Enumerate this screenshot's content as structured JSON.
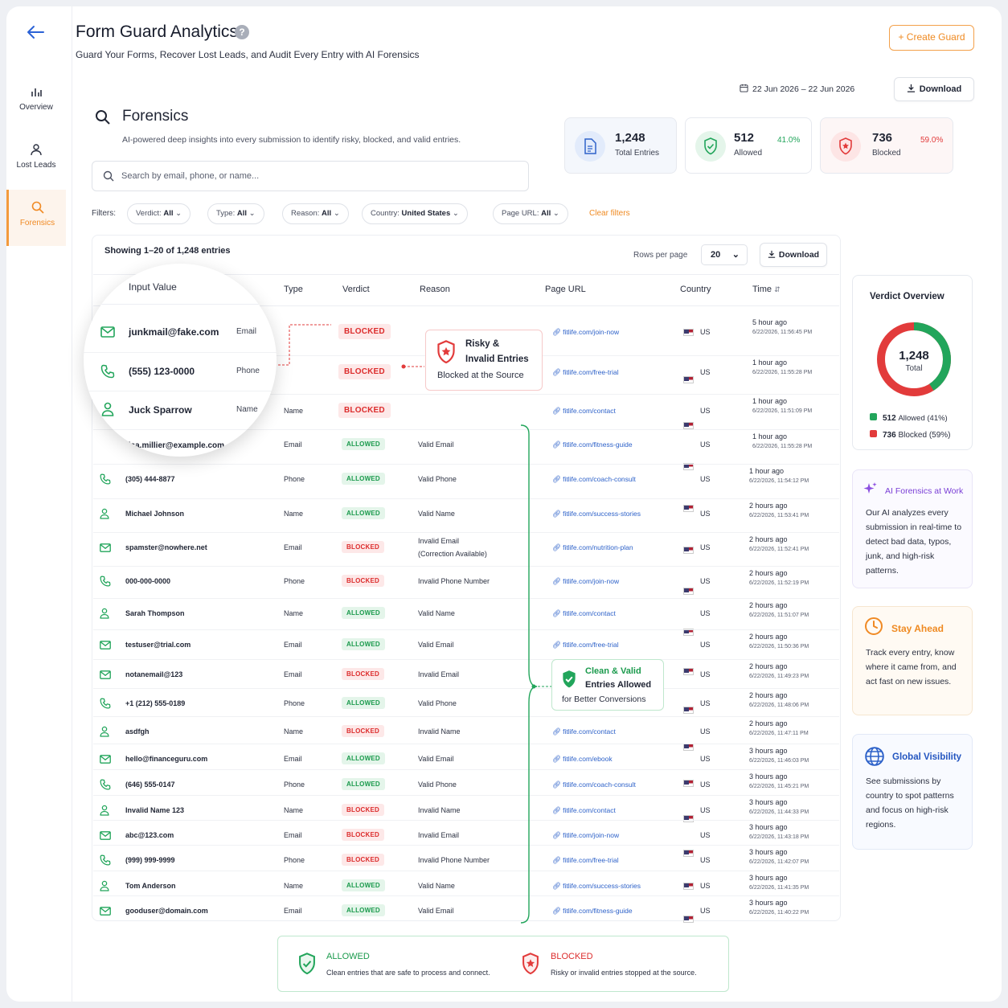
{
  "header": {
    "title": "Form Guard Analytics",
    "help": "?",
    "subtitle": "Guard Your Forms, Recover Lost Leads, and Audit Every Entry with AI Forensics",
    "create_button": "+ Create Guard",
    "date_range": "22 Jun 2026 – 22 Jun 2026",
    "download_button": "Download"
  },
  "sidebar": {
    "items": [
      {
        "label": "Overview",
        "icon": "bar-chart-icon"
      },
      {
        "label": "Lost Leads",
        "icon": "user-icon"
      },
      {
        "label": "Forensics",
        "icon": "search-icon",
        "active": true
      }
    ]
  },
  "forensics": {
    "title": "Forensics",
    "subtitle": "AI-powered deep insights into every submission to identify risky, blocked, and valid entries.",
    "search_placeholder": "Search by email, phone, or name..."
  },
  "stats": {
    "total": {
      "value": "1,248",
      "label": "Total Entries"
    },
    "allowed": {
      "value": "512",
      "label": "Allowed",
      "pct": "41.0%"
    },
    "blocked": {
      "value": "736",
      "label": "Blocked",
      "pct": "59.0%"
    }
  },
  "filters": {
    "label": "Filters:",
    "chips": [
      {
        "name": "Verdict:",
        "value": "All"
      },
      {
        "name": "Type:",
        "value": "All"
      },
      {
        "name": "Reason:",
        "value": "All"
      },
      {
        "name": "Country:",
        "value": "United States"
      },
      {
        "name": "Page URL:",
        "value": "All"
      }
    ],
    "clear": "Clear filters"
  },
  "table": {
    "showing": "Showing 1–20 of 1,248 entries",
    "rows_per_page_label": "Rows per page",
    "rows_per_page": "20",
    "download": "Download",
    "headers": {
      "input": "Input Value",
      "type": "Type",
      "verdict": "Verdict",
      "reason": "Reason",
      "url": "Page URL",
      "country": "Country",
      "time": "Time"
    },
    "rows": [
      {
        "value": "junkmail@fake.com",
        "type": "Email",
        "verdict": "BLOCKED",
        "reason": "",
        "url": "fitlife.com/join-now",
        "country": "US",
        "ago": "5 hour ago",
        "ts": "6/22/2026, 11:56:45 PM",
        "icon": "mail"
      },
      {
        "value": "(555) 123-0000",
        "type": "Phone",
        "verdict": "BLOCKED",
        "reason": "",
        "url": "fitlife.com/free-trial",
        "country": "US",
        "ago": "1 hour ago",
        "ts": "6/22/2026, 11:55:28 PM",
        "icon": "phone"
      },
      {
        "value": "Juck Sparrow",
        "type": "Name",
        "verdict": "BLOCKED",
        "reason": "",
        "url": "fitlife.com/contact",
        "country": "US",
        "ago": "1 hour ago",
        "ts": "6/22/2026, 11:51:09 PM",
        "icon": "user"
      },
      {
        "value": "lisa.millier@example.com",
        "type": "Email",
        "verdict": "ALLOWED",
        "reason": "Valid Email",
        "url": "fitlife.com/fitness-guide",
        "country": "US",
        "ago": "1 hour ago",
        "ts": "6/22/2026, 11:55:28 PM",
        "icon": "mail"
      },
      {
        "value": "(305) 444-8877",
        "type": "Phone",
        "verdict": "ALLOWED",
        "reason": "Valid Phone",
        "url": "fitlife.com/coach-consult",
        "country": "US",
        "ago": "1 hour ago",
        "ts": "6/22/2026, 11:54:12 PM",
        "icon": "phone"
      },
      {
        "value": "Michael Johnson",
        "type": "Name",
        "verdict": "ALLOWED",
        "reason": "Valid Name",
        "url": "fitlife.com/success-stories",
        "country": "US",
        "ago": "2 hours ago",
        "ts": "6/22/2026, 11:53:41 PM",
        "icon": "user"
      },
      {
        "value": "spamster@nowhere.net",
        "type": "Email",
        "verdict": "BLOCKED",
        "reason": "Invalid Email",
        "reason2": "(Correction Available)",
        "url": "fitlife.com/nutrition-plan",
        "country": "US",
        "ago": "2 hours ago",
        "ts": "6/22/2026, 11:52:41 PM",
        "icon": "mail"
      },
      {
        "value": "000-000-0000",
        "type": "Phone",
        "verdict": "BLOCKED",
        "reason": "Invalid Phone Number",
        "url": "fitlife.com/join-now",
        "country": "US",
        "ago": "2 hours ago",
        "ts": "6/22/2026, 11:52:19 PM",
        "icon": "phone"
      },
      {
        "value": "Sarah Thompson",
        "type": "Name",
        "verdict": "ALLOWED",
        "reason": "Valid Name",
        "url": "fitlife.com/contact",
        "country": "US",
        "ago": "2 hours ago",
        "ts": "6/22/2026, 11:51:07 PM",
        "icon": "user"
      },
      {
        "value": "testuser@trial.com",
        "type": "Email",
        "verdict": "ALLOWED",
        "reason": "Valid Email",
        "url": "fitlife.com/free-trial",
        "country": "US",
        "ago": "2 hours ago",
        "ts": "6/22/2026, 11:50:36 PM",
        "icon": "mail"
      },
      {
        "value": "notanemail@123",
        "type": "Email",
        "verdict": "BLOCKED",
        "reason": "Invalid Email",
        "url": "",
        "country": "US",
        "ago": "2 hours ago",
        "ts": "6/22/2026, 11:49:23 PM",
        "icon": "mail"
      },
      {
        "value": "+1 (212) 555-0189",
        "type": "Phone",
        "verdict": "ALLOWED",
        "reason": "Valid Phone",
        "url": "",
        "country": "US",
        "ago": "2 hours ago",
        "ts": "6/22/2026, 11:48:06 PM",
        "icon": "phone"
      },
      {
        "value": "asdfgh",
        "type": "Name",
        "verdict": "BLOCKED",
        "reason": "Invalid Name",
        "url": "fitlife.com/contact",
        "country": "US",
        "ago": "2 hours ago",
        "ts": "6/22/2026, 11:47:11 PM",
        "icon": "user"
      },
      {
        "value": "hello@financeguru.com",
        "type": "Email",
        "verdict": "ALLOWED",
        "reason": "Valid Email",
        "url": "fitlife.com/ebook",
        "country": "US",
        "ago": "3 hours ago",
        "ts": "6/22/2026, 11:46:03 PM",
        "icon": "mail"
      },
      {
        "value": "(646) 555-0147",
        "type": "Phone",
        "verdict": "ALLOWED",
        "reason": "Valid Phone",
        "url": "fitlife.com/coach-consult",
        "country": "US",
        "ago": "3 hours ago",
        "ts": "6/22/2026, 11:45:21 PM",
        "icon": "phone"
      },
      {
        "value": "Invalid Name 123",
        "type": "Name",
        "verdict": "BLOCKED",
        "reason": "Invalid Name",
        "url": "fitlife.com/contact",
        "country": "US",
        "ago": "3 hours ago",
        "ts": "6/22/2026, 11:44:33 PM",
        "icon": "user"
      },
      {
        "value": "abc@123.com",
        "type": "Email",
        "verdict": "BLOCKED",
        "reason": "Invalid Email",
        "url": "fitlife.com/join-now",
        "country": "US",
        "ago": "3 hours ago",
        "ts": "6/22/2026, 11:43:18 PM",
        "icon": "mail"
      },
      {
        "value": "(999) 999-9999",
        "type": "Phone",
        "verdict": "BLOCKED",
        "reason": "Invalid Phone Number",
        "url": "fitlife.com/free-trial",
        "country": "US",
        "ago": "3 hours ago",
        "ts": "6/22/2026, 11:42:07 PM",
        "icon": "phone"
      },
      {
        "value": "Tom Anderson",
        "type": "Name",
        "verdict": "ALLOWED",
        "reason": "Valid Name",
        "url": "fitlife.com/success-stories",
        "country": "US",
        "ago": "3 hours ago",
        "ts": "6/22/2026, 11:41:35 PM",
        "icon": "user"
      },
      {
        "value": "gooduser@domain.com",
        "type": "Email",
        "verdict": "ALLOWED",
        "reason": "Valid Email",
        "url": "fitlife.com/fitness-guide",
        "country": "US",
        "ago": "3 hours ago",
        "ts": "6/22/2026, 11:40:22 PM",
        "icon": "mail"
      }
    ]
  },
  "callouts": {
    "risky": {
      "line1": "Risky &",
      "line2": "Invalid Entries",
      "line3": "Blocked at the Source"
    },
    "clean": {
      "line1": "Clean & Valid",
      "line2": "Entries Allowed",
      "line3": "for Better Conversions"
    }
  },
  "verdict_overview": {
    "title": "Verdict Overview",
    "total": "1,248",
    "total_label": "Total",
    "allowed_value": "512",
    "allowed_label": "Allowed (41%)",
    "blocked_value": "736",
    "blocked_label": "Blocked (59%)",
    "allowed_fraction": 0.41,
    "colors": {
      "allowed": "#22a55b",
      "blocked": "#e23b3b"
    }
  },
  "info_cards": {
    "ai": {
      "title": "AI Forensics at Work",
      "text": "Our AI analyzes every submission in real-time to detect bad data, typos, junk, and high-risk patterns."
    },
    "stay": {
      "title": "Stay Ahead",
      "text": "Track every entry, know where it came from, and act fast on new issues."
    },
    "global": {
      "title": "Global Visibility",
      "text": "See submissions by country to spot patterns and focus on high-risk regions."
    }
  },
  "legend": {
    "allowed_title": "ALLOWED",
    "allowed_text": "Clean entries that are safe to process and connect.",
    "blocked_title": "BLOCKED",
    "blocked_text": "Risky or invalid entries stopped at the source."
  }
}
